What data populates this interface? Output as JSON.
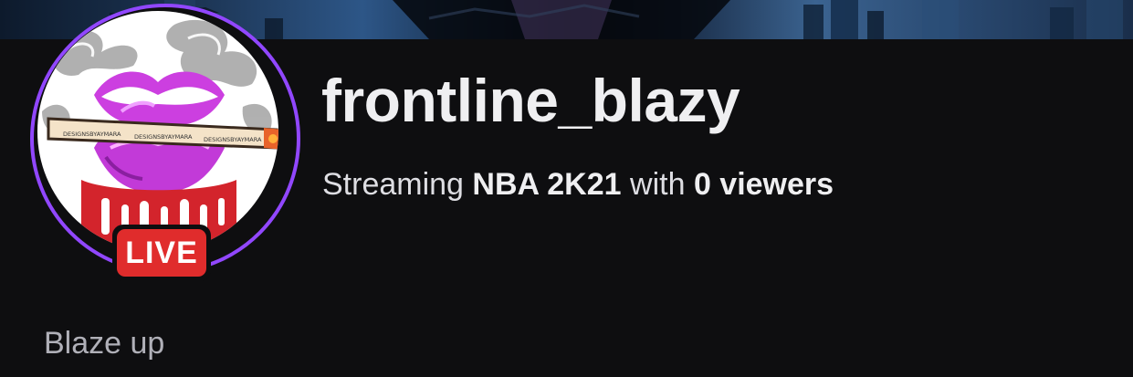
{
  "channel": {
    "name": "frontline_blazy",
    "status_prefix": "Streaming",
    "game": "NBA 2K21",
    "status_middle": "with",
    "viewers": "0 viewers",
    "bio": "Blaze up",
    "live_label": "LIVE",
    "avatar_watermark": "DESIGNSBYAYMARA"
  },
  "colors": {
    "background": "#0e0e10",
    "accent_ring": "#9147ff",
    "live_badge": "#e02c2c"
  },
  "icons": {
    "avatar": "lips-with-joint-avatar",
    "banner": "city-night-banner"
  }
}
